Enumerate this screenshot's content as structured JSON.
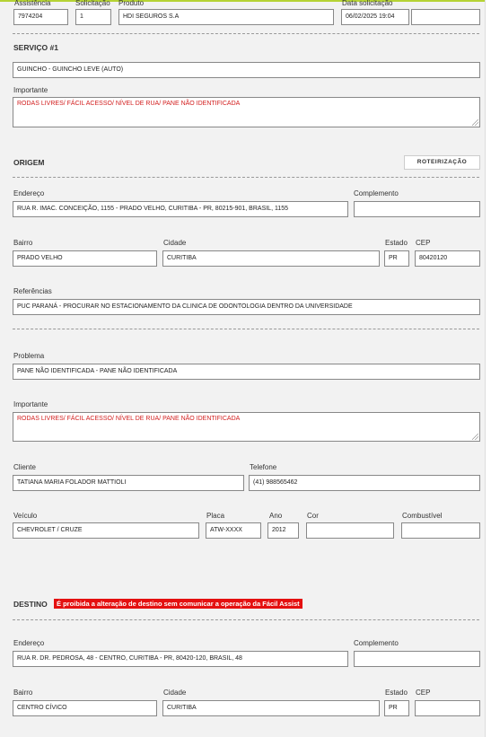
{
  "header": {
    "assistencia": {
      "label": "Assistência",
      "value": "7974204"
    },
    "solicitacao": {
      "label": "Solicitação",
      "value": "1"
    },
    "produto": {
      "label": "Produto",
      "value": "HDI SEGUROS S.A"
    },
    "data_solicitacao": {
      "label": "Data solicitação",
      "value": "06/02/2025 19:04",
      "extra": ""
    }
  },
  "servico": {
    "title": "SERVIÇO #1",
    "value": "GUINCHO - GUINCHO LEVE (AUTO)",
    "importante_label": "Importante",
    "importante_value": "RODAS LIVRES/ FÁCIL ACESSO/ NÍVEL DE RUA/ PANE NÃO IDENTIFICADA"
  },
  "origem": {
    "title": "ORIGEM",
    "button": "ROTEIRIZAÇÃO",
    "endereco_label": "Endereço",
    "endereco": "RUA R. IMAC. CONCEIÇÃO, 1155 - PRADO VELHO, CURITIBA - PR, 80215-901, BRASIL, 1155",
    "complemento_label": "Complemento",
    "complemento": "",
    "bairro_label": "Bairro",
    "bairro": "PRADO VELHO",
    "cidade_label": "Cidade",
    "cidade": "CURITIBA",
    "estado_label": "Estado",
    "estado": "PR",
    "cep_label": "CEP",
    "cep": "80420120",
    "referencias_label": "Referências",
    "referencias": "PUC PARANÁ - PROCURAR NO ESTACIONAMENTO DA CLINICA DE ODONTOLOGIA  DENTRO DA UNIVERSIDADE"
  },
  "problema": {
    "label": "Problema",
    "value": "PANE NÃO IDENTIFICADA - PANE NÃO IDENTIFICADA",
    "importante_label": "Importante",
    "importante_value": "RODAS LIVRES/ FÁCIL ACESSO/ NÍVEL DE RUA/ PANE NÃO IDENTIFICADA"
  },
  "cliente": {
    "label": "Cliente",
    "value": "TATIANA MARIA FOLADOR MATTIOLI",
    "telefone_label": "Telefone",
    "telefone": "(41) 988565462"
  },
  "veiculo": {
    "label": "Veículo",
    "value": "CHEVROLET / CRUZE",
    "placa_label": "Placa",
    "placa": "ATW-XXXX",
    "ano_label": "Ano",
    "ano": "2012",
    "cor_label": "Cor",
    "cor": "",
    "combustivel_label": "Combustível",
    "combustivel": ""
  },
  "destino": {
    "title": "DESTINO",
    "warning": "É proibida a alteração de destino sem comunicar a operação da Fácil Assist",
    "endereco_label": "Endereço",
    "endereco": "RUA R. DR. PEDROSA, 48 - CENTRO, CURITIBA - PR, 80420-120, BRASIL, 48",
    "complemento_label": "Complemento",
    "complemento": "",
    "bairro_label": "Bairro",
    "bairro": "CENTRO CÍVICO",
    "cidade_label": "Cidade",
    "cidade": "CURITIBA",
    "estado_label": "Estado",
    "estado": "PR",
    "cep_label": "CEP",
    "cep": ""
  },
  "colors": {
    "accent": "#b5d334",
    "warning_bg": "#e41010",
    "alert_text": "#d21d1d"
  }
}
